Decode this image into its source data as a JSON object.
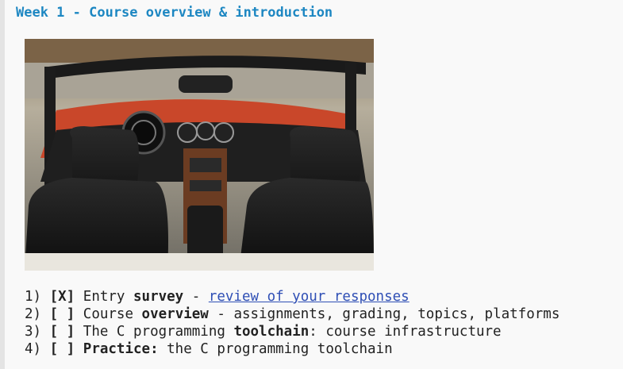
{
  "page_title": "Week 1 - Course overview & introduction",
  "image": {
    "subject": "car-interior-photo"
  },
  "items": [
    {
      "number": "1)",
      "checkbox": "[X]",
      "pre": "Entry ",
      "bold": "survey",
      "post": " - ",
      "link": "review of your responses"
    },
    {
      "number": "2)",
      "checkbox": "[ ]",
      "pre": "Course ",
      "bold": "overview",
      "post": " - assignments, grading, topics, platforms"
    },
    {
      "number": "3)",
      "checkbox": "[ ]",
      "pre": "The C programming ",
      "bold": "toolchain",
      "post": ": course infrastructure"
    },
    {
      "number": "4)",
      "checkbox": "[ ]",
      "pre": "",
      "bold": "Practice:",
      "post": " the C programming toolchain"
    }
  ]
}
